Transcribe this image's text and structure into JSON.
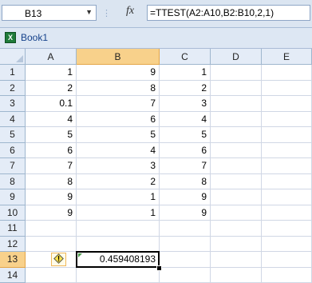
{
  "formula_bar": {
    "name_box": "B13",
    "fx_label": "fx",
    "formula": "=TTEST(A2:A10,B2:B10,2,1)"
  },
  "workbook": {
    "title": "Book1"
  },
  "columns": [
    "A",
    "B",
    "C",
    "D",
    "E"
  ],
  "rows": [
    {
      "num": "1",
      "A": "1",
      "B": "9",
      "C": "1"
    },
    {
      "num": "2",
      "A": "2",
      "B": "8",
      "C": "2"
    },
    {
      "num": "3",
      "A": "0.1",
      "B": "7",
      "C": "3"
    },
    {
      "num": "4",
      "A": "4",
      "B": "6",
      "C": "4"
    },
    {
      "num": "5",
      "A": "5",
      "B": "5",
      "C": "5"
    },
    {
      "num": "6",
      "A": "6",
      "B": "4",
      "C": "6"
    },
    {
      "num": "7",
      "A": "7",
      "B": "3",
      "C": "7"
    },
    {
      "num": "8",
      "A": "8",
      "B": "2",
      "C": "8"
    },
    {
      "num": "9",
      "A": "9",
      "B": "1",
      "C": "9"
    },
    {
      "num": "10",
      "A": "9",
      "B": "1",
      "C": "9"
    },
    {
      "num": "11",
      "A": "",
      "B": "",
      "C": ""
    },
    {
      "num": "12",
      "A": "",
      "B": "",
      "C": ""
    },
    {
      "num": "13",
      "A": "",
      "B": "0.459408193",
      "C": ""
    },
    {
      "num": "14",
      "A": "",
      "B": "",
      "C": ""
    }
  ],
  "selection": {
    "cell": "B13",
    "column": "B",
    "row": "13"
  },
  "icons": {
    "error_indicator": "error-warning-icon",
    "workbook": "excel-book-icon",
    "fx": "function-icon"
  }
}
